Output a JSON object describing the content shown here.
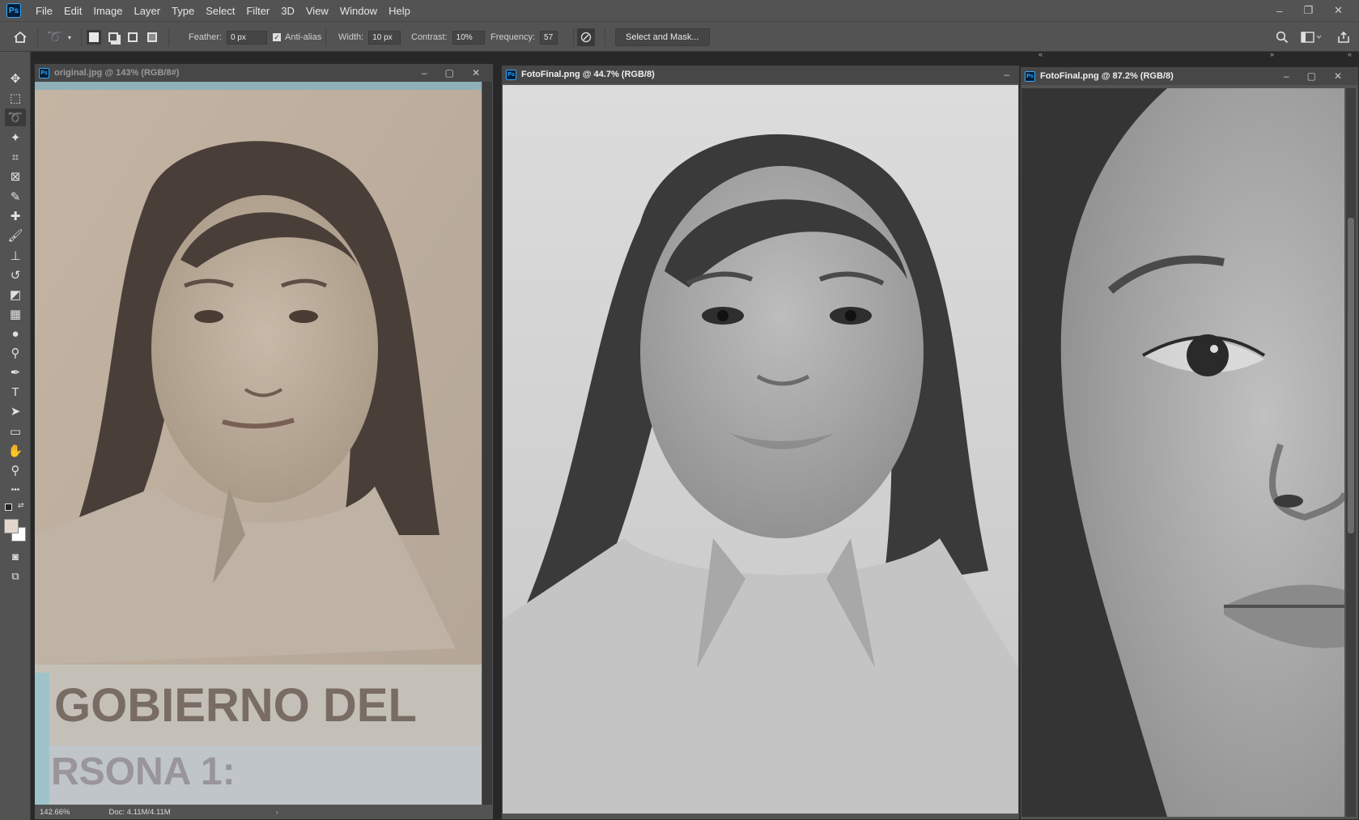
{
  "app": {
    "logo_text": "Ps"
  },
  "menu": [
    "File",
    "Edit",
    "Image",
    "Layer",
    "Type",
    "Select",
    "Filter",
    "3D",
    "View",
    "Window",
    "Help"
  ],
  "window_controls": {
    "minimize": "–",
    "restore": "❐",
    "close": "✕"
  },
  "options_bar": {
    "feather_label": "Feather:",
    "feather_value": "0 px",
    "antialias_label": "Anti-alias",
    "antialias_checked": true,
    "width_label": "Width:",
    "width_value": "10 px",
    "contrast_label": "Contrast:",
    "contrast_value": "10%",
    "frequency_label": "Frequency:",
    "frequency_value": "57",
    "select_mask_label": "Select and Mask..."
  },
  "tools": [
    {
      "name": "move-tool",
      "glyph": "✥"
    },
    {
      "name": "marquee-tool",
      "glyph": "⬚"
    },
    {
      "name": "lasso-tool",
      "glyph": "➰",
      "active": true
    },
    {
      "name": "magic-wand-tool",
      "glyph": "✦"
    },
    {
      "name": "crop-tool",
      "glyph": "⌗"
    },
    {
      "name": "frame-tool",
      "glyph": "⊠"
    },
    {
      "name": "eyedropper-tool",
      "glyph": "✎"
    },
    {
      "name": "healing-tool",
      "glyph": "✚"
    },
    {
      "name": "brush-tool",
      "glyph": "🖌"
    },
    {
      "name": "stamp-tool",
      "glyph": "⊥"
    },
    {
      "name": "history-brush-tool",
      "glyph": "↺"
    },
    {
      "name": "eraser-tool",
      "glyph": "◩"
    },
    {
      "name": "gradient-tool",
      "glyph": "▦"
    },
    {
      "name": "blur-tool",
      "glyph": "●"
    },
    {
      "name": "dodge-tool",
      "glyph": "⚲"
    },
    {
      "name": "pen-tool",
      "glyph": "✒"
    },
    {
      "name": "type-tool",
      "glyph": "T"
    },
    {
      "name": "path-selection-tool",
      "glyph": "➤"
    },
    {
      "name": "rectangle-tool",
      "glyph": "▭"
    },
    {
      "name": "hand-tool",
      "glyph": "✋"
    },
    {
      "name": "zoom-tool",
      "glyph": "⚲"
    },
    {
      "name": "more-tools",
      "glyph": "•••"
    }
  ],
  "colors": {
    "foreground": "#e2d7cc",
    "background": "#ffffff",
    "accent": "#31a8ff"
  },
  "documents": [
    {
      "title": "original.jpg @ 143% (RGB/8#)",
      "zoom": "142.66%",
      "doc_size": "Doc: 4.11M/4.11M",
      "stamp_text_1": "GOBIERNO DEL",
      "stamp_text_2": "RSONA 1:"
    },
    {
      "title": "FotoFinal.png @ 44.7% (RGB/8)"
    },
    {
      "title": "FotoFinal.png @ 87.2% (RGB/8)"
    }
  ]
}
